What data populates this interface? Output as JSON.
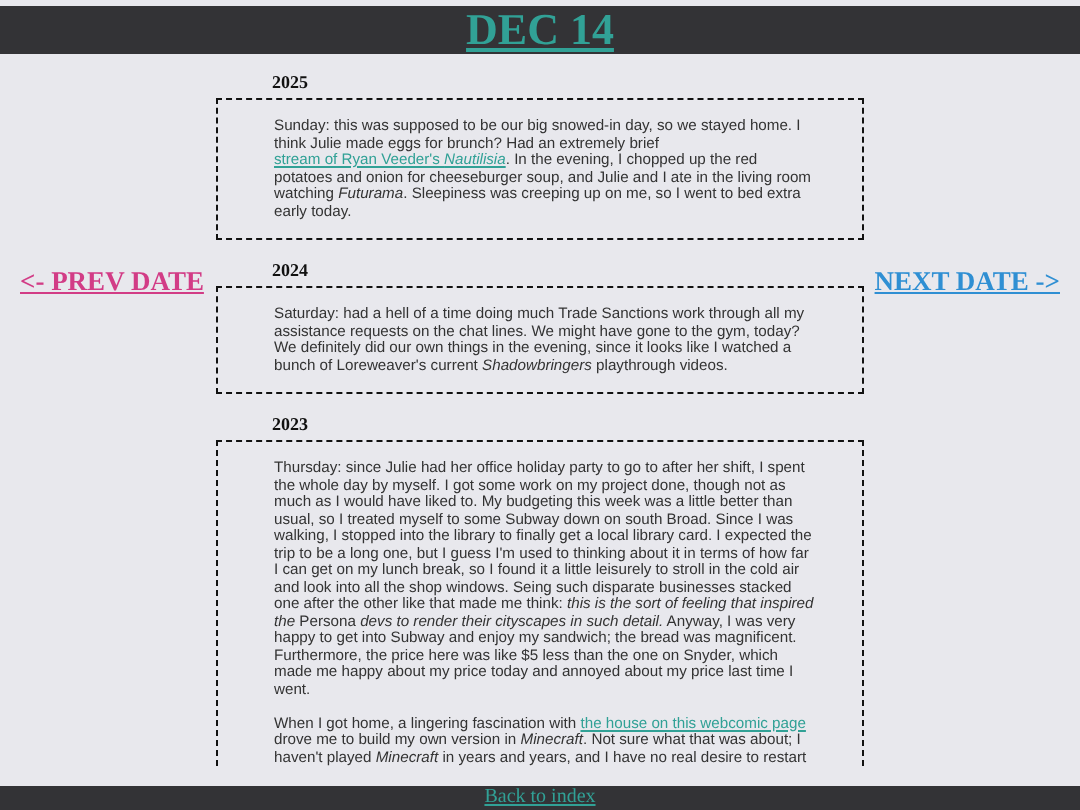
{
  "header": {
    "title": "DEC 14"
  },
  "nav": {
    "prev": "<- PREV DATE",
    "next": "NEXT DATE ->"
  },
  "entries": [
    {
      "year": "2025",
      "paragraphs": [
        [
          {
            "kind": "text",
            "text": "Sunday: this was supposed to be our big snowed-in day, so we stayed home. I think Julie made eggs for brunch? Had an extremely brief "
          },
          {
            "kind": "link",
            "text": "stream of Ryan Veeder's *Nautilisia*"
          },
          {
            "kind": "text",
            "text": ". In the evening, I chopped up the red potatoes and onion for cheeseburger soup, and Julie and I ate in the living room watching *Futurama*. Sleepiness was creeping up on me, so I went to bed extra early today."
          }
        ]
      ]
    },
    {
      "year": "2024",
      "paragraphs": [
        [
          {
            "kind": "text",
            "text": "Saturday: had a hell of a time doing much Trade Sanctions work through all my assistance requests on the chat lines. We might have gone to the gym, today? We definitely did our own things in the evening, since it looks like I watched a bunch of Loreweaver's current *Shadowbringers* playthrough videos."
          }
        ]
      ]
    },
    {
      "year": "2023",
      "paragraphs": [
        [
          {
            "kind": "text",
            "text": "Thursday: since Julie had her office holiday party to go to after her shift, I spent the whole day by myself. I got some work on my project done, though not as much as I would have liked to. My budgeting this week was a little better than usual, so I treated myself to some Subway down on south Broad. Since I was walking, I stopped into the library to finally get a local library card. I expected the trip to be a long one, but I guess I'm used to thinking about it in terms of how far I can get on my lunch break, so I found it a little leisurely to stroll in the cold air and look into all the shop windows. Seing such disparate businesses stacked one after the other like that made me think: *this is the sort of feeling that inspired the* Persona *devs to render their cityscapes in such detail.* Anyway, I was very happy to get into Subway and enjoy my sandwich; the bread was magnificent. Furthermore, the price here was like $5 less than the one on Snyder, which made me happy about my price today and annoyed about my price last time I went."
          }
        ],
        [
          {
            "kind": "text",
            "text": "When I got home, a lingering fascination with "
          },
          {
            "kind": "link",
            "text": "the house on this webcomic page"
          },
          {
            "kind": "text",
            "text": " drove me to build my own version in *Minecraft*. Not sure what that was about; I haven't played *Minecraft* in years and years, and I have no real desire to restart"
          }
        ]
      ]
    }
  ],
  "footer": {
    "link": "Back to index"
  }
}
